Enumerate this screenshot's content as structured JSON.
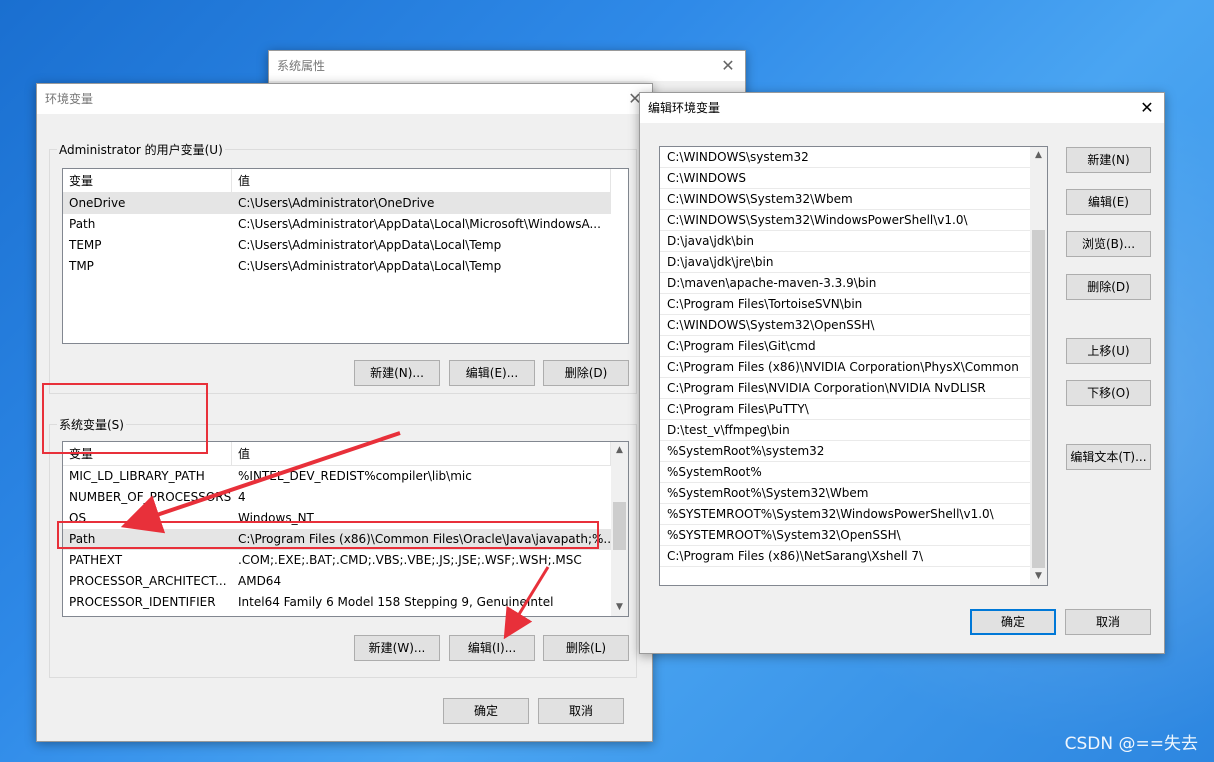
{
  "desktop": {
    "watermark": "CSDN @==失去"
  },
  "sys_props": {
    "title": "系统属性"
  },
  "env_vars": {
    "title": "环境变量",
    "user_group_label": "Administrator 的用户变量(U)",
    "user_headers": [
      "变量",
      "值"
    ],
    "user_rows": [
      {
        "name": "OneDrive",
        "value": "C:\\Users\\Administrator\\OneDrive"
      },
      {
        "name": "Path",
        "value": "C:\\Users\\Administrator\\AppData\\Local\\Microsoft\\WindowsA..."
      },
      {
        "name": "TEMP",
        "value": "C:\\Users\\Administrator\\AppData\\Local\\Temp"
      },
      {
        "name": "TMP",
        "value": "C:\\Users\\Administrator\\AppData\\Local\\Temp"
      }
    ],
    "user_buttons": {
      "new": "新建(N)...",
      "edit": "编辑(E)...",
      "delete": "删除(D)"
    },
    "sys_group_label": "系统变量(S)",
    "sys_headers": [
      "变量",
      "值"
    ],
    "sys_rows": [
      {
        "name": "MIC_LD_LIBRARY_PATH",
        "value": "%INTEL_DEV_REDIST%compiler\\lib\\mic"
      },
      {
        "name": "NUMBER_OF_PROCESSORS",
        "value": "4"
      },
      {
        "name": "OS",
        "value": "Windows_NT"
      },
      {
        "name": "Path",
        "value": "C:\\Program Files (x86)\\Common Files\\Oracle\\Java\\javapath;%..."
      },
      {
        "name": "PATHEXT",
        "value": ".COM;.EXE;.BAT;.CMD;.VBS;.VBE;.JS;.JSE;.WSF;.WSH;.MSC"
      },
      {
        "name": "PROCESSOR_ARCHITECT...",
        "value": "AMD64"
      },
      {
        "name": "PROCESSOR_IDENTIFIER",
        "value": "Intel64 Family 6 Model 158 Stepping 9, GenuineIntel"
      }
    ],
    "sys_buttons": {
      "new": "新建(W)...",
      "edit": "编辑(I)...",
      "delete": "删除(L)"
    },
    "ok": "确定",
    "cancel": "取消"
  },
  "edit_env": {
    "title": "编辑环境变量",
    "entries": [
      "C:\\WINDOWS\\system32",
      "C:\\WINDOWS",
      "C:\\WINDOWS\\System32\\Wbem",
      "C:\\WINDOWS\\System32\\WindowsPowerShell\\v1.0\\",
      "D:\\java\\jdk\\bin",
      "D:\\java\\jdk\\jre\\bin",
      "D:\\maven\\apache-maven-3.3.9\\bin",
      "C:\\Program Files\\TortoiseSVN\\bin",
      "C:\\WINDOWS\\System32\\OpenSSH\\",
      "C:\\Program Files\\Git\\cmd",
      "C:\\Program Files (x86)\\NVIDIA Corporation\\PhysX\\Common",
      "C:\\Program Files\\NVIDIA Corporation\\NVIDIA NvDLISR",
      "C:\\Program Files\\PuTTY\\",
      "D:\\test_v\\ffmpeg\\bin",
      "%SystemRoot%\\system32",
      "%SystemRoot%",
      "%SystemRoot%\\System32\\Wbem",
      "%SYSTEMROOT%\\System32\\WindowsPowerShell\\v1.0\\",
      "%SYSTEMROOT%\\System32\\OpenSSH\\",
      "C:\\Program Files (x86)\\NetSarang\\Xshell 7\\"
    ],
    "buttons": {
      "new": "新建(N)",
      "edit": "编辑(E)",
      "browse": "浏览(B)...",
      "delete": "删除(D)",
      "move_up": "上移(U)",
      "move_down": "下移(O)",
      "edit_text": "编辑文本(T)..."
    },
    "ok": "确定",
    "cancel": "取消"
  }
}
